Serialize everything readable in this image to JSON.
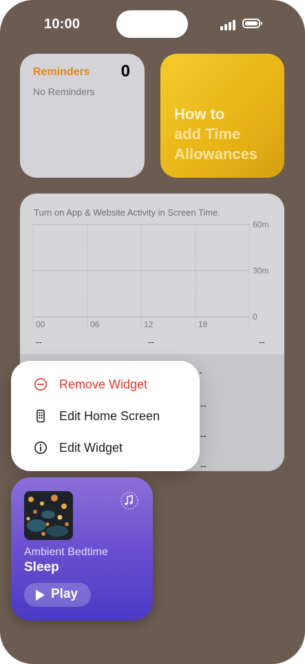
{
  "status_bar": {
    "time": "10:00"
  },
  "reminders_widget": {
    "title": "Reminders",
    "count": "0",
    "empty_text": "No Reminders"
  },
  "tips_widget": {
    "line1": "How to",
    "line2": "add Time",
    "line3": "Allowances"
  },
  "screen_time_widget": {
    "message": "Turn on App & Website Activity in Screen Time.",
    "y_labels": [
      "60m",
      "30m",
      "0"
    ],
    "x_labels": [
      "00",
      "06",
      "12",
      "18"
    ],
    "summary_values": [
      "--",
      "--",
      "--"
    ],
    "lower_values": [
      "--",
      "--",
      "--",
      "--"
    ]
  },
  "context_menu": {
    "items": [
      {
        "label": "Remove Widget",
        "icon": "minus-circle-icon",
        "color": "#e5352d"
      },
      {
        "label": "Edit Home Screen",
        "icon": "phone-apps-icon"
      },
      {
        "label": "Edit Widget",
        "icon": "info-circle-icon"
      }
    ]
  },
  "music_widget": {
    "subtitle": "Ambient Bedtime",
    "title": "Sleep",
    "play_label": "Play",
    "icon": "music-note-icon"
  },
  "colors": {
    "wallpaper": "#6b5b50",
    "reminders_accent": "#e38717",
    "tips_yellow": "#e7b416",
    "destructive": "#e5352d",
    "music_purple": "#6a4fcf"
  }
}
